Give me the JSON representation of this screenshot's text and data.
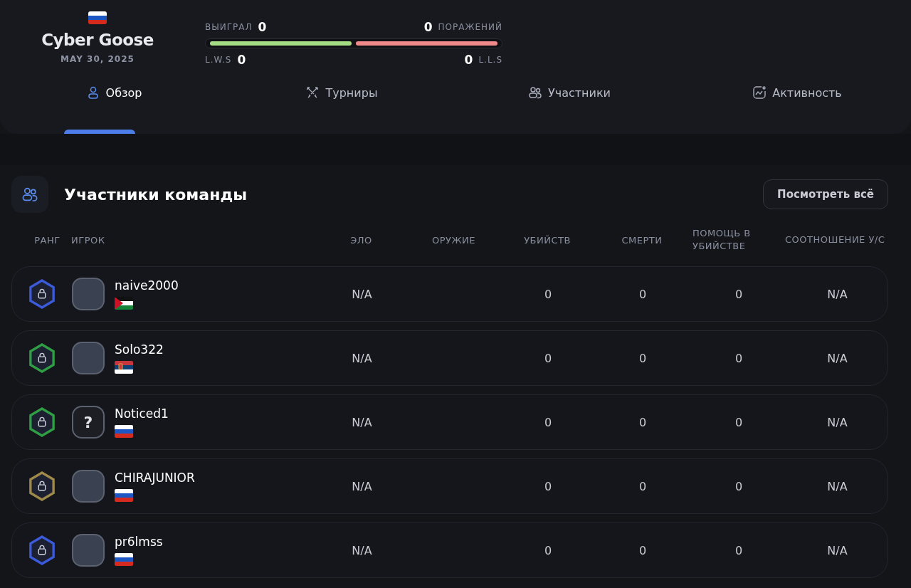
{
  "team": {
    "flag": {
      "kind": "ru"
    },
    "name": "Cyber Goose",
    "date": "MAY 30, 2025"
  },
  "stats": {
    "wins_label": "ВЫИГРАЛ",
    "wins": "0",
    "losses": "0",
    "losses_label": "ПОРАЖЕНИЙ",
    "lws_label": "L.W.S",
    "lws": "0",
    "lls": "0",
    "lls_label": "L.L.S"
  },
  "tabs": [
    {
      "label": "Обзор",
      "kind": "user",
      "selected": true
    },
    {
      "label": "Турниры",
      "kind": "swords",
      "selected": false
    },
    {
      "label": "Участники",
      "kind": "users",
      "selected": false
    },
    {
      "label": "Активность",
      "kind": "chart",
      "selected": false
    }
  ],
  "section": {
    "title": "Участники команды",
    "button": "Посмотреть всё"
  },
  "table": {
    "columns": [
      "РАНГ",
      "ИГРОК",
      "ЭЛО",
      "ОРУЖИЕ",
      "УБИЙСТВ",
      "СМЕРТИ",
      "ПОМОЩЬ В УБИЙСТВЕ",
      "СООТНОШЕНИЕ У/С"
    ],
    "rows": [
      {
        "rank": {
          "color": "#3b5bdb"
        },
        "player": "naive2000",
        "avatar": {
          "kind": "photo"
        },
        "flag": {
          "kind": "jo"
        },
        "elo": "N/A",
        "kills": "0",
        "deaths": "0",
        "assists": "0",
        "ratio": "N/A"
      },
      {
        "rank": {
          "color": "#2f9e44"
        },
        "player": "Solo322",
        "avatar": {
          "kind": "photo"
        },
        "flag": {
          "kind": "rs"
        },
        "elo": "N/A",
        "kills": "0",
        "deaths": "0",
        "assists": "0",
        "ratio": "N/A"
      },
      {
        "rank": {
          "color": "#2f9e44"
        },
        "player": "Noticed1",
        "avatar": {
          "kind": "unknown",
          "text": "?"
        },
        "flag": {
          "kind": "ru"
        },
        "elo": "N/A",
        "kills": "0",
        "deaths": "0",
        "assists": "0",
        "ratio": "N/A"
      },
      {
        "rank": {
          "color": "#a08a4a"
        },
        "player": "CHIRAJUNIOR",
        "avatar": {
          "kind": "photo"
        },
        "flag": {
          "kind": "ru"
        },
        "elo": "N/A",
        "kills": "0",
        "deaths": "0",
        "assists": "0",
        "ratio": "N/A"
      },
      {
        "rank": {
          "color": "#3b5bdb"
        },
        "player": "pr6lmss",
        "avatar": {
          "kind": "photo"
        },
        "flag": {
          "kind": "ru"
        },
        "elo": "N/A",
        "kills": "0",
        "deaths": "0",
        "assists": "0",
        "ratio": "N/A"
      }
    ]
  }
}
